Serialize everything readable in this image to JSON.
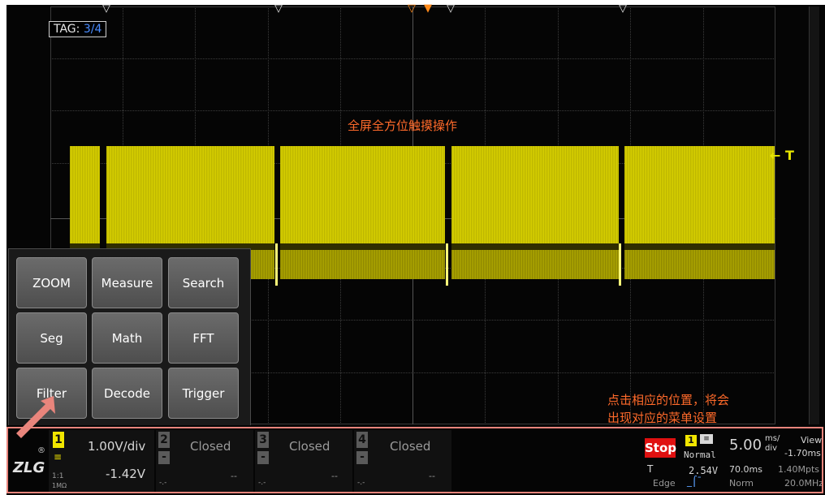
{
  "screen": {
    "tag_label": "TAG:",
    "tag_value": "3/4",
    "trigger_marker": "← T",
    "annotation_top": "全屏全方位触摸操作",
    "annotation_bottom_1": "点击相应的位置，将会",
    "annotation_bottom_2": "出现对应的菜单设置"
  },
  "menu": {
    "buttons": [
      "ZOOM",
      "Measure",
      "Search",
      "Seg",
      "Math",
      "FFT",
      "Filter",
      "Decode",
      "Trigger"
    ]
  },
  "status_bar": {
    "logo": "ZLG",
    "ch1": {
      "number": "1",
      "scale": "1.00V/div",
      "offset": "-1.42V",
      "coupling": "1:1",
      "impedance": "1MΩ"
    },
    "ch2": {
      "number": "2",
      "state": "Closed",
      "dash": "--",
      "minus": "-",
      "sub": "-.-"
    },
    "ch3": {
      "number": "3",
      "state": "Closed",
      "dash": "--",
      "minus": "-",
      "sub": "-.-"
    },
    "ch4": {
      "number": "4",
      "state": "Closed",
      "dash": "--",
      "minus": "-",
      "sub": "-.-"
    },
    "run_state": "Stop",
    "trigger_source": "1",
    "trigger_mode": "Normal",
    "trigger_letter": "T",
    "trigger_level": "2.54V",
    "trigger_type": "Edge",
    "timebase": "5.00",
    "timebase_unit_top": "ms/",
    "timebase_unit_bottom": "div",
    "view_label": "View",
    "view_value": "-1.70ms",
    "delay": "70.0ms",
    "memory": "1.40Mpts",
    "acq_mode": "Norm",
    "sample_rate": "20.0MHz"
  },
  "colors": {
    "ch1": "#f2e600",
    "annotation": "#ff6a2a",
    "stop": "#e01010",
    "highlight_border": "#e9857c"
  }
}
